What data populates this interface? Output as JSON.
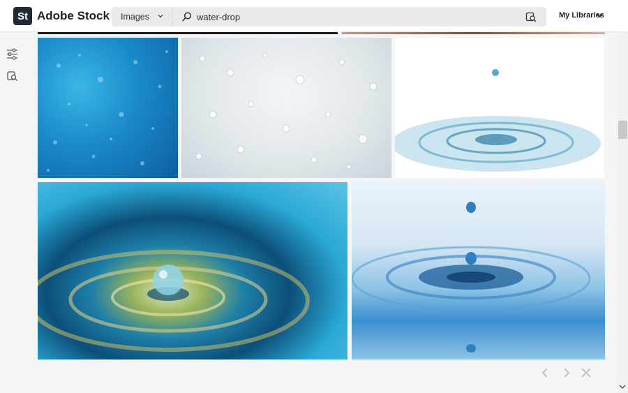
{
  "header": {
    "logo_text": "St",
    "brand": "Adobe Stock",
    "search": {
      "type_value": "Images",
      "query": "water-drop"
    },
    "libraries_label": "My Libraries"
  },
  "icons": {
    "search": "search-icon",
    "visual_search": "visual-search-icon",
    "filters": "filters-icon",
    "chevron_down": "chevron-down-icon",
    "prev": "chevron-left-icon",
    "next": "chevron-right-icon",
    "close": "close-icon"
  },
  "results": [
    {
      "id": "img1",
      "description": "blue water droplets"
    },
    {
      "id": "img2",
      "description": "white water droplets"
    },
    {
      "id": "img3",
      "description": "drop ripple on white"
    },
    {
      "id": "img4",
      "description": "golden ripple water drop"
    },
    {
      "id": "img5",
      "description": "blue falling drops ripple"
    }
  ],
  "colors": {
    "logo_bg": "#1f2a35",
    "header_bg": "#ffffff",
    "page_bg": "#f5f5f5"
  }
}
